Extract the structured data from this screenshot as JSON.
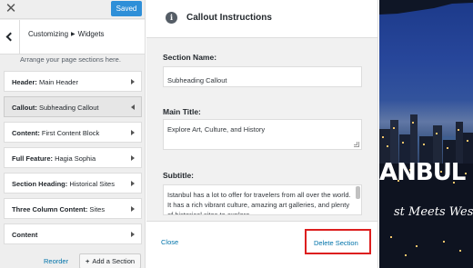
{
  "sidebar": {
    "close_icon": "close-icon",
    "saved_label": "Saved",
    "breadcrumb": {
      "parent": "Customizing",
      "current": "Widgets"
    },
    "hint": "Arrange your page sections here.",
    "sections": [
      {
        "bold": "Header:",
        "rest": " Main Header",
        "active": false
      },
      {
        "bold": "Callout:",
        "rest": " Subheading Callout",
        "active": true
      },
      {
        "bold": "Content:",
        "rest": " First Content Block",
        "active": false
      },
      {
        "bold": "Full Feature:",
        "rest": " Hagia Sophia",
        "active": false
      },
      {
        "bold": "Section Heading:",
        "rest": " Historical Sites",
        "active": false
      },
      {
        "bold": "Three Column Content:",
        "rest": " Sites",
        "active": false
      },
      {
        "bold": "Content",
        "rest": "",
        "active": false
      }
    ],
    "reorder_label": "Reorder",
    "add_section_label": "Add a Section"
  },
  "panel": {
    "title": "Callout Instructions",
    "section_name_label": "Section Name:",
    "section_name_value": "Subheading Callout",
    "main_title_label": "Main Title:",
    "main_title_value": "Explore Art, Culture, and History",
    "subtitle_label": "Subtitle:",
    "subtitle_value": "Istanbul has a lot to offer for travelers from all over the world. It has a rich vibrant culture, amazing art galleries, and plenty of historical sites to explore.",
    "close_label": "Close",
    "delete_label": "Delete Section"
  },
  "preview": {
    "title": "ANBUL",
    "subtitle": "st Meets West"
  },
  "colors": {
    "accent": "#2e8fd8",
    "link": "#0073aa",
    "highlight_border": "#dd1f1f"
  }
}
